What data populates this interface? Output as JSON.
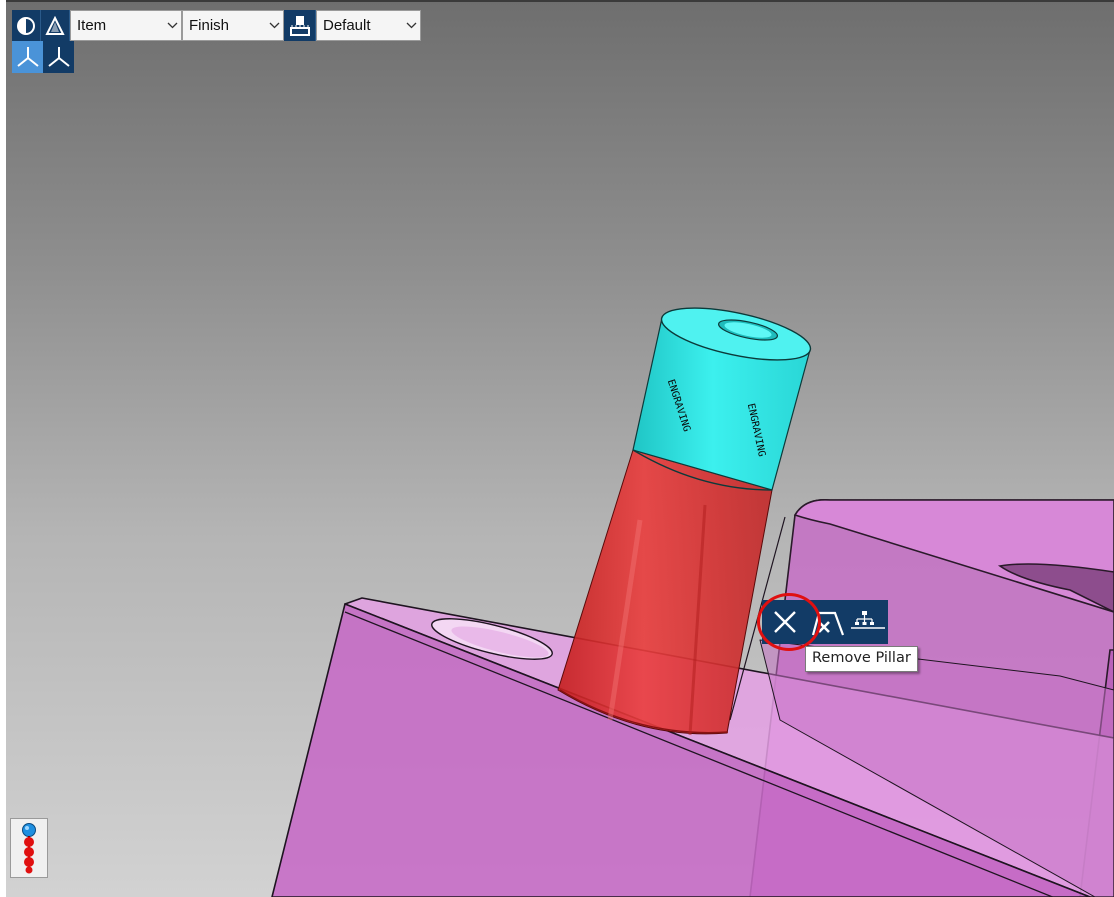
{
  "toolbar": {
    "combo1": {
      "value": "Item"
    },
    "combo2": {
      "value": "Finish"
    },
    "combo3": {
      "value": "Default"
    },
    "buttons": [
      "shade-icon",
      "transparency-icon",
      "view-plane-icon"
    ]
  },
  "axes": [
    "axis-view-1-icon",
    "axis-view-2-icon"
  ],
  "scene": {
    "pillar_top_color": "#2ee6e6",
    "pillar_bottom_color": "#e23a3a",
    "part_color": "#d87ad8",
    "engraving_left": "ENGRAVING",
    "engraving_right": "ENGRAVING"
  },
  "palette": {
    "buttons": [
      "remove-pillar-icon",
      "remove-sketch-icon",
      "pillar-tree-icon"
    ]
  },
  "tooltip": {
    "text": "Remove Pillar"
  },
  "colors": {
    "toolbar_blue": "#123b66",
    "highlight_red": "#e01010"
  }
}
